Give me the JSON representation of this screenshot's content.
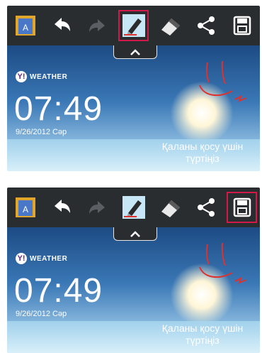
{
  "screens": [
    {
      "widget": {
        "brand": "WEATHER",
        "time": "07:49",
        "date": "9/26/2012 Сәр",
        "city_prompt_line1": "Қаланы қосу үшін",
        "city_prompt_line2": "түртіңіз"
      },
      "highlighted_tool": "pen-tool"
    },
    {
      "widget": {
        "brand": "WEATHER",
        "time": "07:49",
        "date": "9/26/2012 Сәр",
        "city_prompt_line1": "Қаланы қосу үшін",
        "city_prompt_line2": "түртіңіз"
      },
      "highlighted_tool": "save-tool"
    }
  ],
  "toolbar": {
    "icons": [
      "background-icon",
      "undo-icon",
      "redo-icon",
      "pen-icon",
      "eraser-icon",
      "share-icon",
      "save-icon"
    ],
    "highlight_color": "#d11a4a"
  },
  "ink_color": "#e0312f"
}
